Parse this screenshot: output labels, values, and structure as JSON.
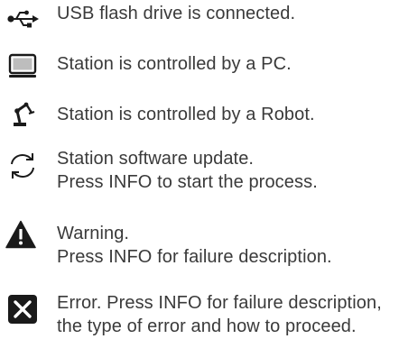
{
  "legend": {
    "usb": {
      "icon": "usb-icon",
      "text": "USB flash drive is connected."
    },
    "pc": {
      "icon": "monitor-icon",
      "text": "Station is controlled by a PC."
    },
    "robot": {
      "icon": "robot-arm-icon",
      "text": "Station is controlled by a Robot."
    },
    "update": {
      "icon": "refresh-icon",
      "line1": "Station software update.",
      "line2": "Press INFO to start the process."
    },
    "warning": {
      "icon": "warning-icon",
      "line1": "Warning.",
      "line2": "Press INFO for failure description."
    },
    "error": {
      "icon": "error-icon",
      "line1": "Error. Press INFO for failure description,",
      "line2": "the type of error and how to proceed."
    }
  },
  "colors": {
    "text": "#3a3a3a",
    "icon": "#1a1a1a"
  }
}
